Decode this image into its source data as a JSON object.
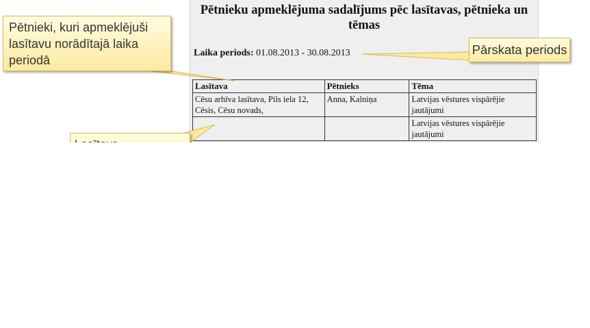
{
  "report": {
    "title": "Pētnieku apmeklējuma sadalījums pēc lasītavas, pētnieka un tēmas",
    "period_label": "Laika periods:",
    "period_value": "01.08.2013 - 30.08.2013",
    "table": {
      "headers": [
        "Lasītava",
        "Pētnieks",
        "Tēma"
      ],
      "rows": [
        [
          "Cēsu arhīva lasītava, Pils iela 12, Cēsis, Cēsu novads,",
          "Anna, Kalniņa",
          "Latvijas vēstures vispārējie jautājumi"
        ],
        [
          "",
          "",
          "Latvijas vēstures vispārējie jautājumi"
        ]
      ]
    }
  },
  "callouts": {
    "researchers": "Pētnieki, kuri apmeklējuši lasītavu norādītajā laika periodā",
    "period": "Pārskata periods",
    "reading_room": "Lasītava"
  },
  "colors": {
    "callout_fill": "#fdf3b8",
    "callout_border": "#d9b84f",
    "page_background": "#efefef"
  }
}
